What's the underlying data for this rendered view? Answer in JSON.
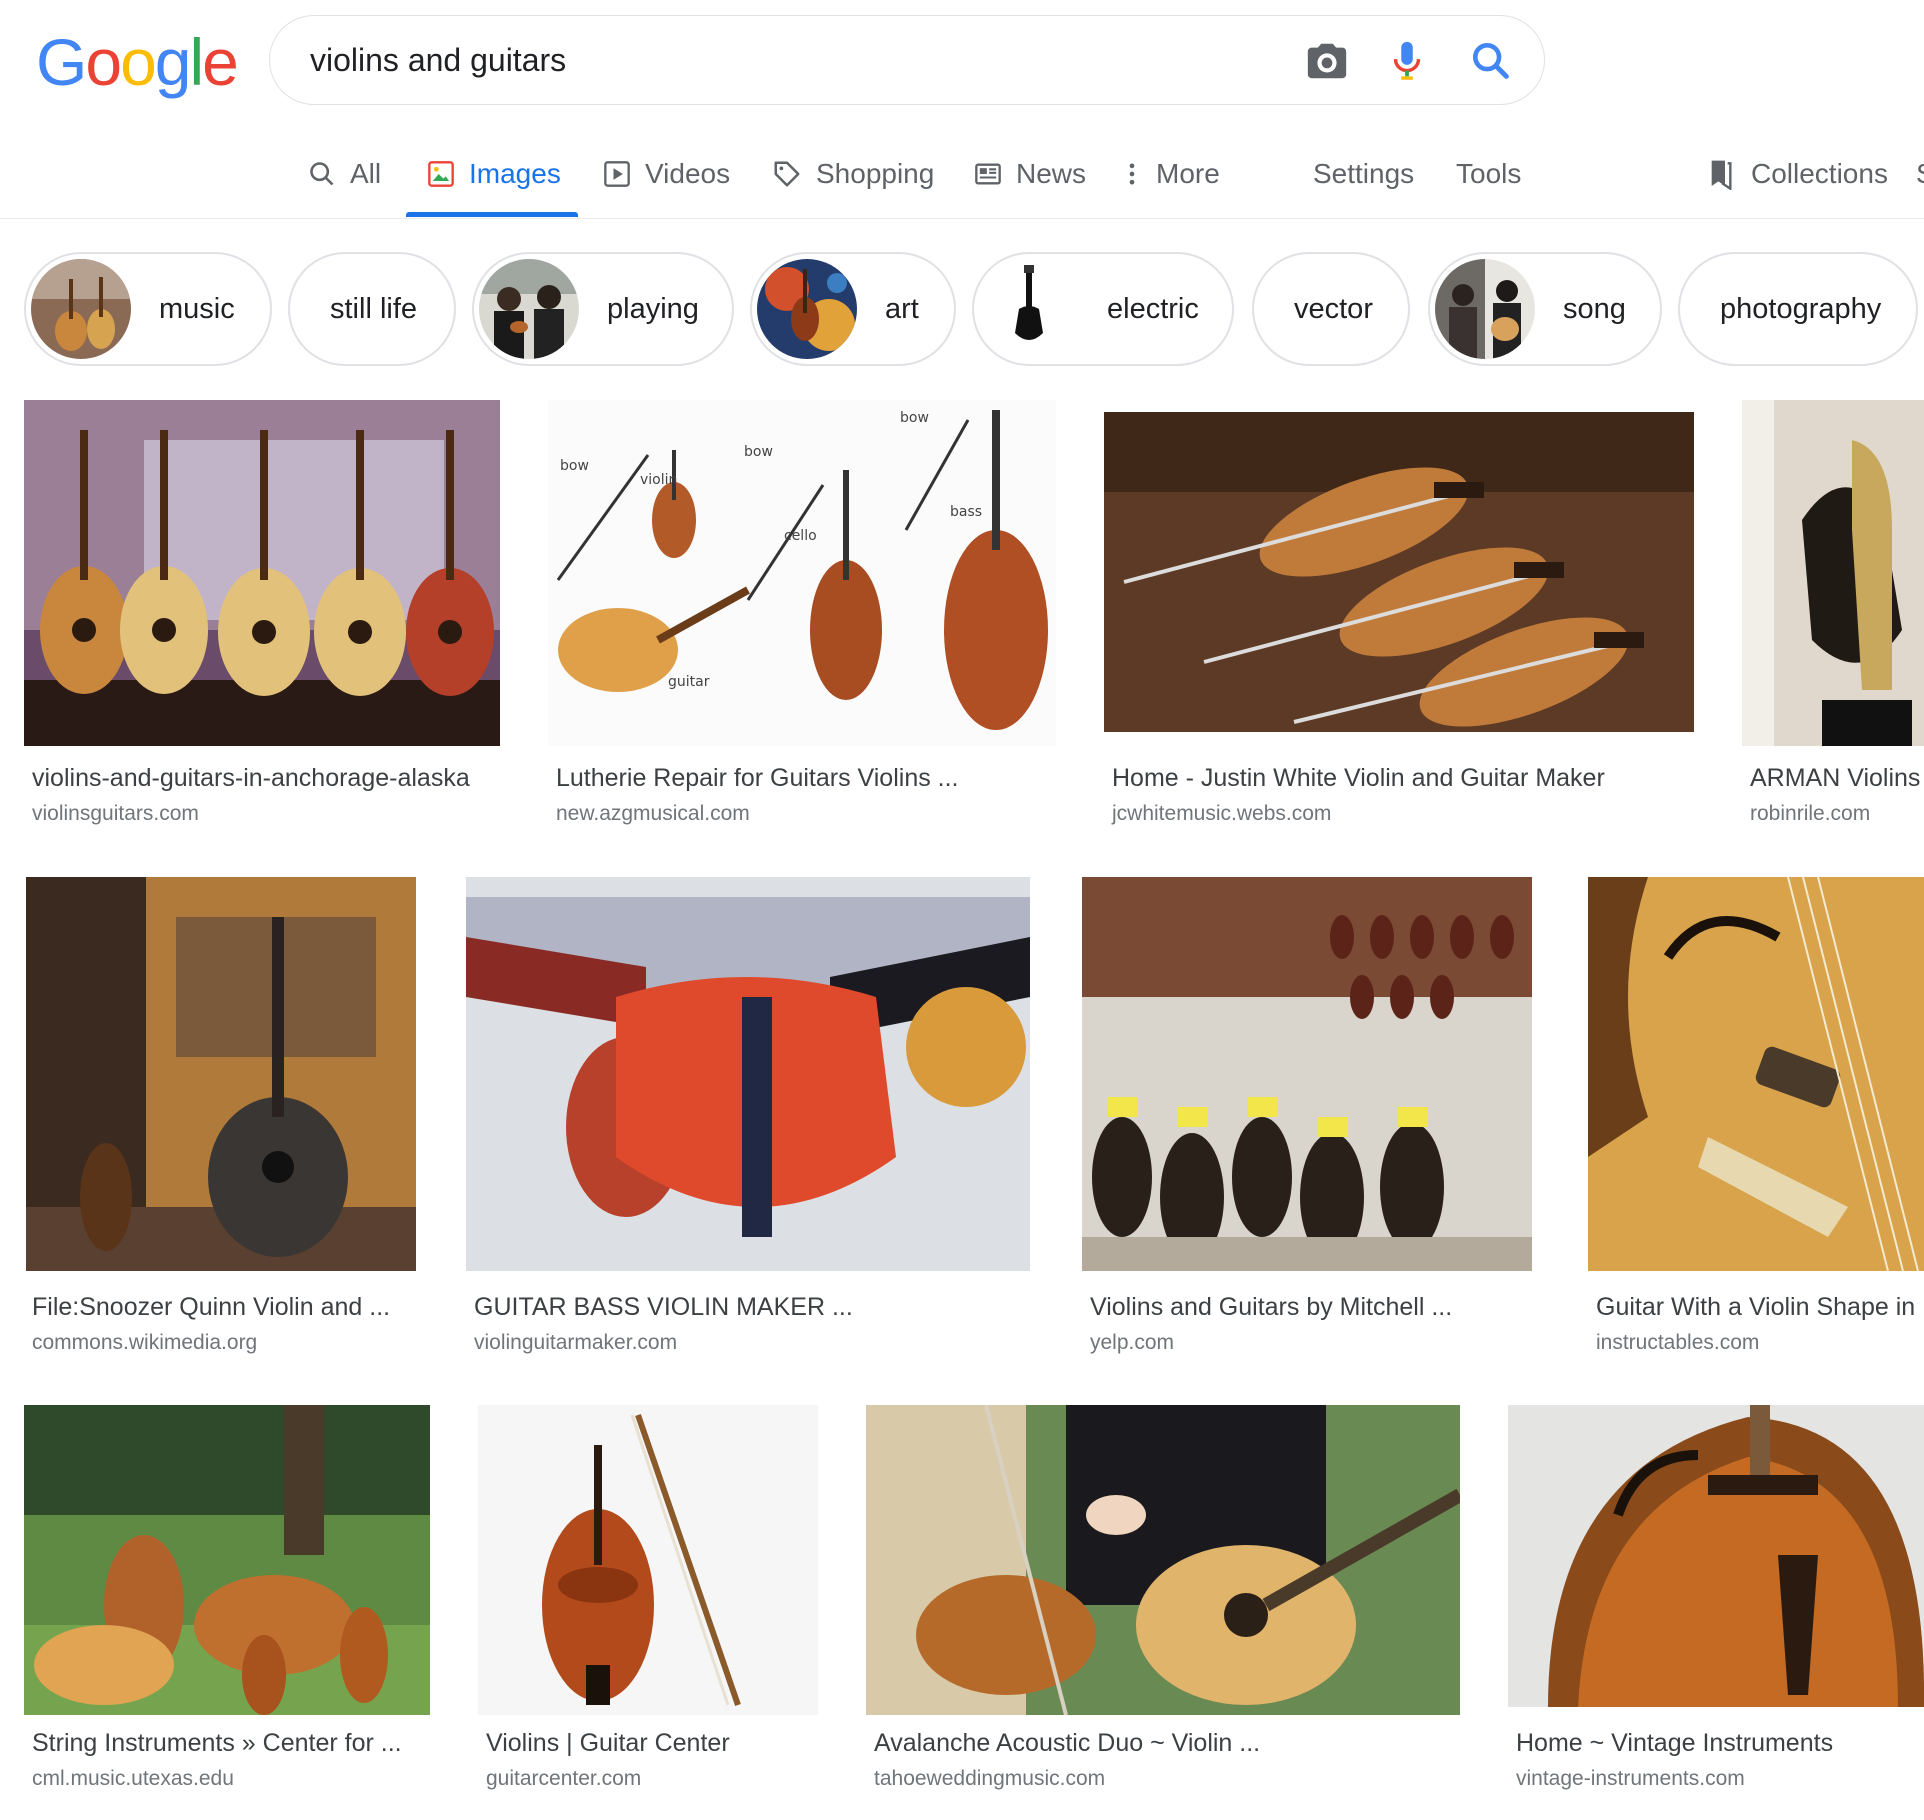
{
  "logo": {
    "letters": [
      "G",
      "o",
      "o",
      "g",
      "l",
      "e"
    ],
    "colors": [
      "#4285f4",
      "#ea4335",
      "#fbbc05",
      "#4285f4",
      "#34a853",
      "#ea4335"
    ]
  },
  "search": {
    "query": "violins and guitars"
  },
  "tabs": [
    {
      "label": "All",
      "icon": "search-icon"
    },
    {
      "label": "Images",
      "icon": "image-icon",
      "active": true
    },
    {
      "label": "Videos",
      "icon": "play-icon"
    },
    {
      "label": "Shopping",
      "icon": "tag-icon"
    },
    {
      "label": "News",
      "icon": "newspaper-icon"
    },
    {
      "label": "More",
      "icon": "more-vert-icon"
    }
  ],
  "tools": {
    "settings": "Settings",
    "tools": "Tools",
    "collections": "Collections",
    "next_cut": "S"
  },
  "chips": [
    {
      "label": "music"
    },
    {
      "label": "still life"
    },
    {
      "label": "playing"
    },
    {
      "label": "art"
    },
    {
      "label": "electric"
    },
    {
      "label": "vector"
    },
    {
      "label": "song"
    },
    {
      "label": "photography"
    }
  ],
  "results": [
    {
      "title": "violins-and-guitars-in-anchorage-alaska",
      "source": "violinsguitars.com"
    },
    {
      "title": "Lutherie Repair for Guitars Violins ...",
      "source": "new.azgmusical.com",
      "diagram_labels": [
        "bow",
        "violin",
        "bow",
        "cello",
        "bow",
        "bass",
        "guitar"
      ]
    },
    {
      "title": "Home - Justin White Violin and Guitar Maker",
      "source": "jcwhitemusic.webs.com"
    },
    {
      "title": "ARMAN Violins",
      "source": "robinrile.com"
    },
    {
      "title": "File:Snoozer Quinn Violin and ...",
      "source": "commons.wikimedia.org"
    },
    {
      "title": "GUITAR BASS VIOLIN MAKER ...",
      "source": "violinguitarmaker.com"
    },
    {
      "title": "Violins and Guitars by Mitchell ...",
      "source": "yelp.com"
    },
    {
      "title": "Guitar With a Violin Shape in M",
      "source": "instructables.com"
    },
    {
      "title": "String Instruments » Center for ...",
      "source": "cml.music.utexas.edu"
    },
    {
      "title": "Violins | Guitar Center",
      "source": "guitarcenter.com"
    },
    {
      "title": "Avalanche Acoustic Duo ~ Violin ...",
      "source": "tahoeweddingmusic.com"
    },
    {
      "title": "Home ~ Vintage Instruments",
      "source": "vintage-instruments.com"
    }
  ]
}
